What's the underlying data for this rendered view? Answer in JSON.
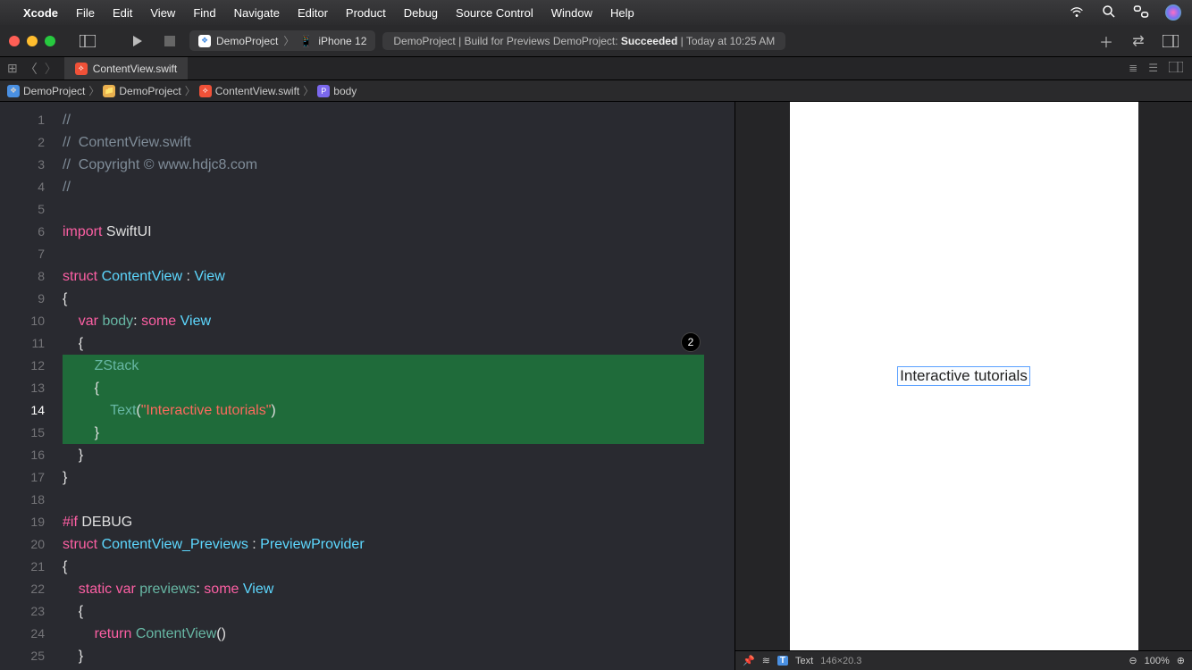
{
  "menubar": {
    "app": "Xcode",
    "items": [
      "File",
      "Edit",
      "View",
      "Find",
      "Navigate",
      "Editor",
      "Product",
      "Debug",
      "Source Control",
      "Window",
      "Help"
    ]
  },
  "toolbar": {
    "scheme_project": "DemoProject",
    "scheme_device": "iPhone 12",
    "status_prefix": "DemoProject | Build for Previews DemoProject: ",
    "status_result": "Succeeded",
    "status_time": " | Today at 10:25 AM"
  },
  "tab": {
    "filename": "ContentView.swift"
  },
  "breadcrumb": {
    "items": [
      "DemoProject",
      "DemoProject",
      "ContentView.swift",
      "body"
    ]
  },
  "code": {
    "badge": "2",
    "lines": [
      {
        "n": 1,
        "seg": [
          {
            "c": "c-comment",
            "t": "//"
          }
        ]
      },
      {
        "n": 2,
        "seg": [
          {
            "c": "c-comment",
            "t": "//  ContentView.swift"
          }
        ]
      },
      {
        "n": 3,
        "seg": [
          {
            "c": "c-comment",
            "t": "//  Copyright © www.hdjc8.com"
          }
        ]
      },
      {
        "n": 4,
        "seg": [
          {
            "c": "c-comment",
            "t": "//"
          }
        ]
      },
      {
        "n": 5,
        "seg": []
      },
      {
        "n": 6,
        "seg": [
          {
            "c": "c-keyword",
            "t": "import"
          },
          {
            "c": "c-plain",
            "t": " SwiftUI"
          }
        ]
      },
      {
        "n": 7,
        "seg": []
      },
      {
        "n": 8,
        "seg": [
          {
            "c": "c-keyword",
            "t": "struct"
          },
          {
            "c": "c-plain",
            "t": " "
          },
          {
            "c": "c-type",
            "t": "ContentView"
          },
          {
            "c": "c-plain",
            "t": " : "
          },
          {
            "c": "c-type",
            "t": "View"
          }
        ]
      },
      {
        "n": 9,
        "seg": [
          {
            "c": "c-plain",
            "t": "{"
          }
        ]
      },
      {
        "n": 10,
        "seg": [
          {
            "c": "c-plain",
            "t": "    "
          },
          {
            "c": "c-keyword",
            "t": "var"
          },
          {
            "c": "c-plain",
            "t": " "
          },
          {
            "c": "c-teal",
            "t": "body"
          },
          {
            "c": "c-plain",
            "t": ": "
          },
          {
            "c": "c-keyword",
            "t": "some"
          },
          {
            "c": "c-plain",
            "t": " "
          },
          {
            "c": "c-type",
            "t": "View"
          }
        ]
      },
      {
        "n": 11,
        "seg": [
          {
            "c": "c-plain",
            "t": "    {"
          }
        ]
      },
      {
        "n": 12,
        "hl": true,
        "seg": [
          {
            "c": "c-plain",
            "t": "        "
          },
          {
            "c": "c-teal",
            "t": "ZStack"
          }
        ]
      },
      {
        "n": 13,
        "hl": true,
        "seg": [
          {
            "c": "c-plain",
            "t": "        {"
          }
        ]
      },
      {
        "n": 14,
        "hl": true,
        "current": true,
        "seg": [
          {
            "c": "c-plain",
            "t": "            "
          },
          {
            "c": "c-teal",
            "t": "Text"
          },
          {
            "c": "c-plain",
            "t": "("
          },
          {
            "c": "c-string",
            "t": "\"Interactive tutorials\""
          },
          {
            "c": "c-plain",
            "t": ")"
          }
        ]
      },
      {
        "n": 15,
        "hl": true,
        "seg": [
          {
            "c": "c-plain",
            "t": "        }"
          }
        ]
      },
      {
        "n": 16,
        "seg": [
          {
            "c": "c-plain",
            "t": "    }"
          }
        ]
      },
      {
        "n": 17,
        "seg": [
          {
            "c": "c-plain",
            "t": "}"
          }
        ]
      },
      {
        "n": 18,
        "seg": []
      },
      {
        "n": 19,
        "seg": [
          {
            "c": "c-keyword",
            "t": "#if"
          },
          {
            "c": "c-plain",
            "t": " DEBUG"
          }
        ]
      },
      {
        "n": 20,
        "seg": [
          {
            "c": "c-keyword",
            "t": "struct"
          },
          {
            "c": "c-plain",
            "t": " "
          },
          {
            "c": "c-type",
            "t": "ContentView_Previews"
          },
          {
            "c": "c-plain",
            "t": " : "
          },
          {
            "c": "c-type",
            "t": "PreviewProvider"
          }
        ]
      },
      {
        "n": 21,
        "seg": [
          {
            "c": "c-plain",
            "t": "{"
          }
        ]
      },
      {
        "n": 22,
        "seg": [
          {
            "c": "c-plain",
            "t": "    "
          },
          {
            "c": "c-keyword",
            "t": "static"
          },
          {
            "c": "c-plain",
            "t": " "
          },
          {
            "c": "c-keyword",
            "t": "var"
          },
          {
            "c": "c-plain",
            "t": " "
          },
          {
            "c": "c-teal",
            "t": "previews"
          },
          {
            "c": "c-plain",
            "t": ": "
          },
          {
            "c": "c-keyword",
            "t": "some"
          },
          {
            "c": "c-plain",
            "t": " "
          },
          {
            "c": "c-type",
            "t": "View"
          }
        ]
      },
      {
        "n": 23,
        "seg": [
          {
            "c": "c-plain",
            "t": "    {"
          }
        ]
      },
      {
        "n": 24,
        "seg": [
          {
            "c": "c-plain",
            "t": "        "
          },
          {
            "c": "c-keyword",
            "t": "return"
          },
          {
            "c": "c-plain",
            "t": " "
          },
          {
            "c": "c-teal",
            "t": "ContentView"
          },
          {
            "c": "c-plain",
            "t": "()"
          }
        ]
      },
      {
        "n": 25,
        "seg": [
          {
            "c": "c-plain",
            "t": "    }"
          }
        ]
      }
    ]
  },
  "preview": {
    "text": "Interactive tutorials",
    "status_label": "Text",
    "status_size": "146×20.3",
    "zoom": "100%"
  }
}
